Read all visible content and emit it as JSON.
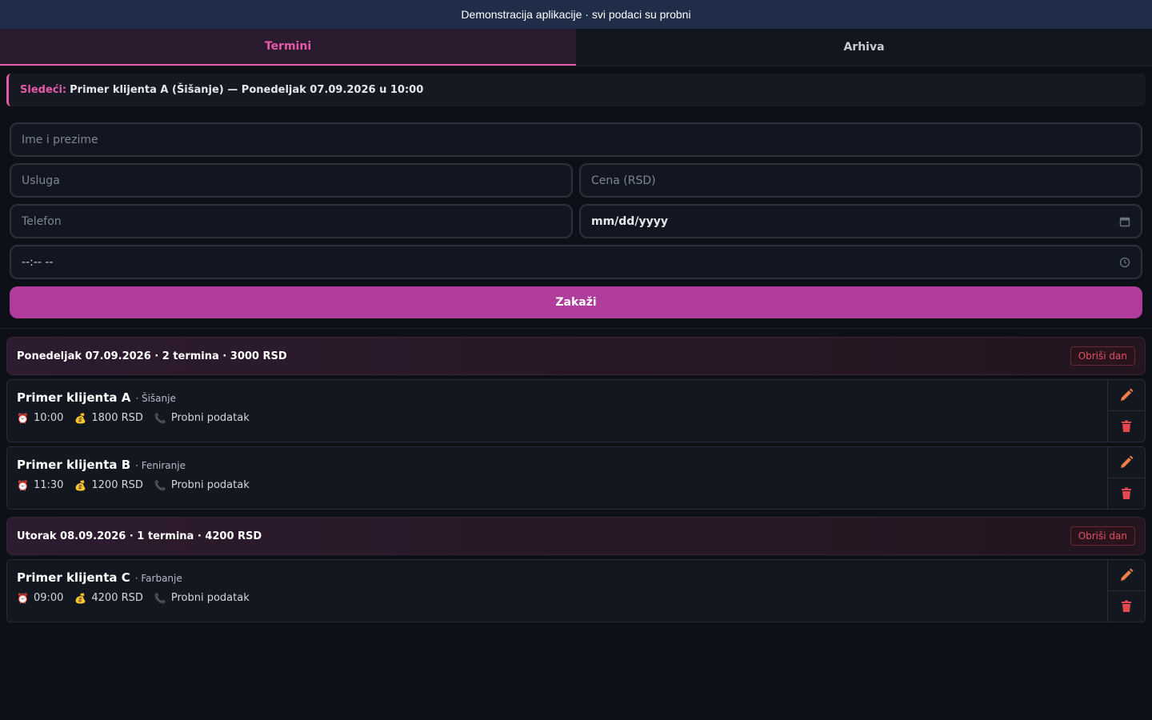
{
  "banner": "Demonstracija aplikacije · svi podaci su probni",
  "tabs": [
    {
      "label": "Termini",
      "active": true
    },
    {
      "label": "Arhiva",
      "active": false
    }
  ],
  "next": {
    "label": "Sledeći:",
    "text": "Primer klijenta A (Šišanje) — Ponedeljak 07.09.2026 u 10:00"
  },
  "form": {
    "name_placeholder": "Ime i prezime",
    "service_placeholder": "Usluga",
    "price_placeholder": "Cena (RSD)",
    "phone_placeholder": "Telefon",
    "date_value": "mm/dd/yyyy",
    "time_value": "--:-- --",
    "submit_label": "Zakaži"
  },
  "days": [
    {
      "header": "Ponedeljak 07.09.2026 · 2 termina · 3000 RSD",
      "delete_label": "Obriši dan",
      "appointments": [
        {
          "name": "Primer klijenta A",
          "service": "· Šišanje",
          "time": "10:00",
          "price": "1800 RSD",
          "phone": "Probni podatak"
        },
        {
          "name": "Primer klijenta B",
          "service": "· Feniranje",
          "time": "11:30",
          "price": "1200 RSD",
          "phone": "Probni podatak"
        }
      ]
    },
    {
      "header": "Utorak 08.09.2026 · 1 termina · 4200 RSD",
      "delete_label": "Obriši dan",
      "appointments": [
        {
          "name": "Primer klijenta C",
          "service": "· Farbanje",
          "time": "09:00",
          "price": "4200 RSD",
          "phone": "Probni podatak"
        }
      ]
    }
  ],
  "colors": {
    "accent": "#e85aa8",
    "button": "#b03c9b",
    "danger": "#e05065",
    "edit_icon": "#f07e4a"
  },
  "icons": {
    "time": "alarm-clock-icon",
    "price": "money-bag-icon",
    "phone": "phone-icon",
    "edit": "pencil-icon",
    "delete": "trash-icon",
    "date": "calendar-icon",
    "clock": "clock-icon"
  }
}
